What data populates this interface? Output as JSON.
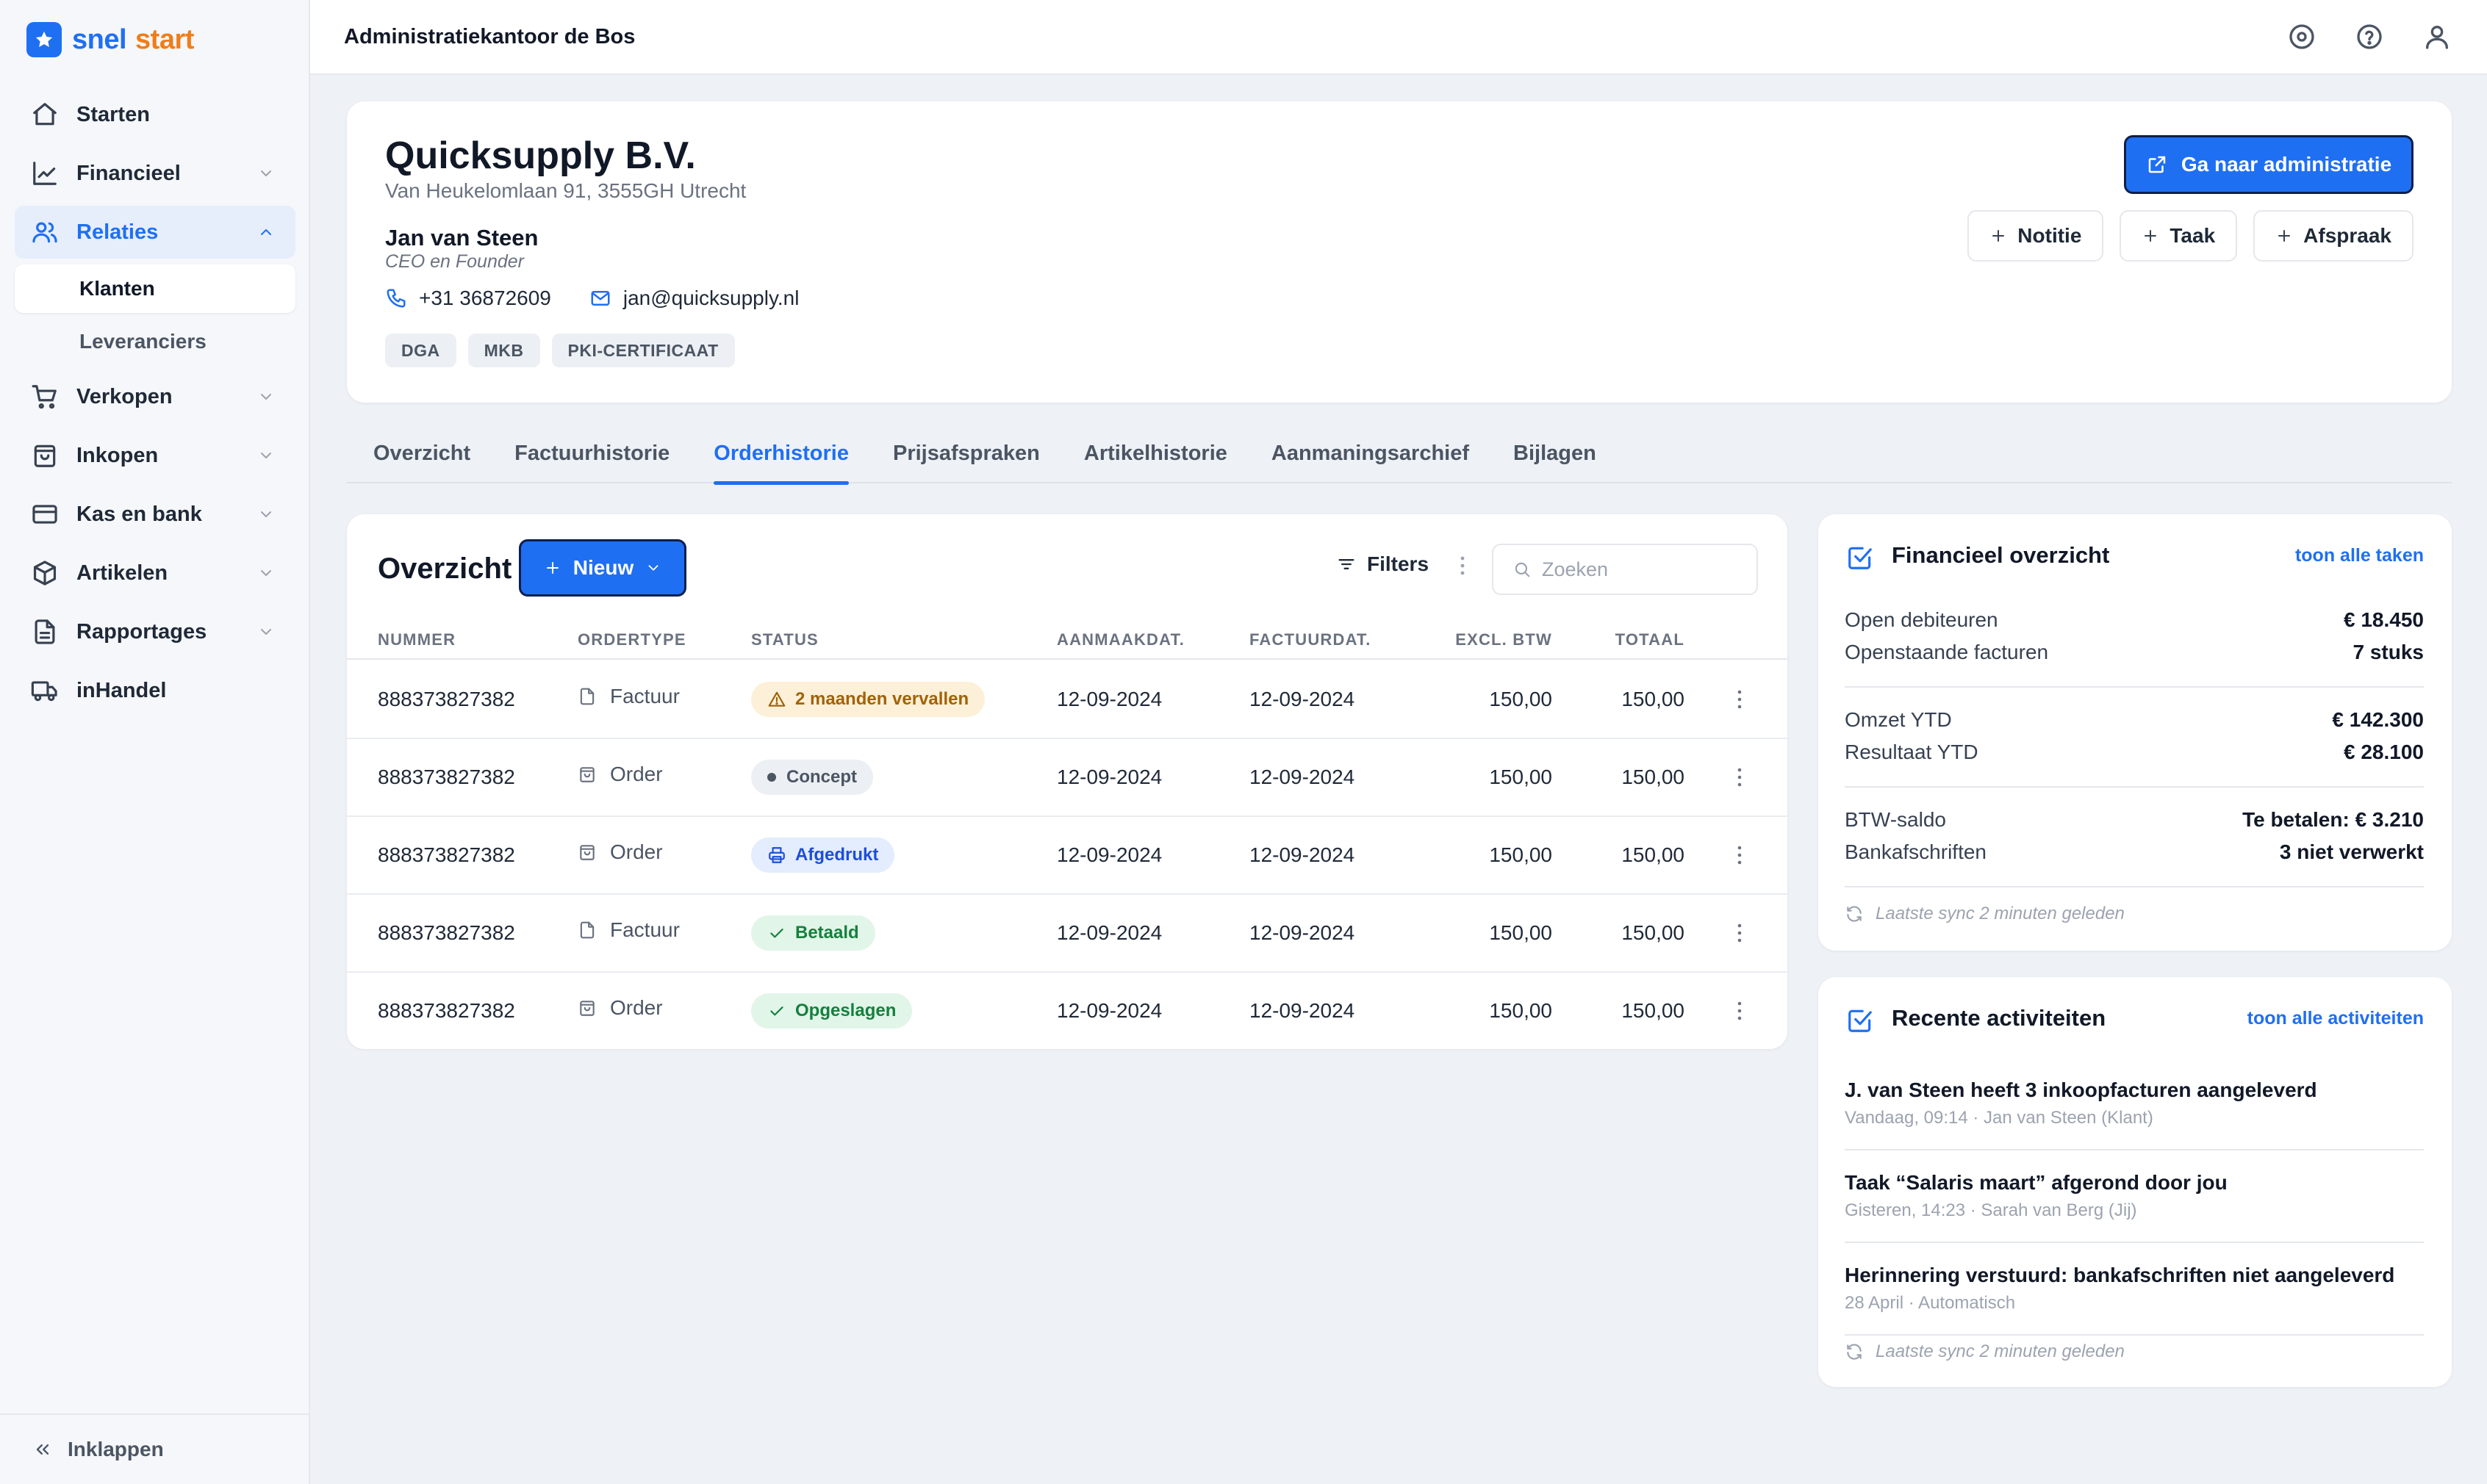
{
  "brand": {
    "part1": "snel",
    "part2": "start"
  },
  "sidebar": {
    "items": [
      {
        "label": "Starten",
        "icon": "home-icon"
      },
      {
        "label": "Financieel",
        "icon": "chart-line-icon"
      },
      {
        "label": "Relaties",
        "icon": "users-icon"
      },
      {
        "label": "Verkopen",
        "icon": "cart-icon"
      },
      {
        "label": "Inkopen",
        "icon": "shopping-bag-icon"
      },
      {
        "label": "Kas en bank",
        "icon": "credit-card-icon"
      },
      {
        "label": "Artikelen",
        "icon": "box-icon"
      },
      {
        "label": "Rapportages",
        "icon": "file-text-icon"
      },
      {
        "label": "inHandel",
        "icon": "truck-icon"
      }
    ],
    "sub_items": [
      {
        "label": "Klanten"
      },
      {
        "label": "Leveranciers"
      }
    ],
    "collapse_label": "Inklappen"
  },
  "topbar": {
    "title": "Administratiekantoor de Bos"
  },
  "customer": {
    "name": "Quicksupply B.V.",
    "address": "Van Heukelomlaan 91, 3555GH Utrecht",
    "contact_name": "Jan van Steen",
    "contact_role": "CEO en Founder",
    "phone": "+31 36872609",
    "email": "jan@quicksupply.nl",
    "tags": [
      "DGA",
      "MKB",
      "PKI-CERTIFICAAT"
    ],
    "primary_action": "Ga naar administratie",
    "actions": [
      "Notitie",
      "Taak",
      "Afspraak"
    ]
  },
  "tabs": [
    "Overzicht",
    "Factuurhistorie",
    "Orderhistorie",
    "Prijsafspraken",
    "Artikelhistorie",
    "Aanmaningsarchief",
    "Bijlagen"
  ],
  "orders": {
    "title": "Overzicht",
    "new_label": "Nieuw",
    "filters_label": "Filters",
    "search_placeholder": "Zoeken",
    "columns": [
      "NUMMER",
      "ORDERTYPE",
      "STATUS",
      "AANMAAKDAT.",
      "FACTUURDAT.",
      "EXCL. BTW",
      "TOTAAL"
    ],
    "rows": [
      {
        "number": "888373827382",
        "type": "Factuur",
        "status": "2 maanden vervallen",
        "created": "12-09-2024",
        "invoiced": "12-09-2024",
        "excl": "150,00",
        "total": "150,00"
      },
      {
        "number": "888373827382",
        "type": "Order",
        "status": "Concept",
        "created": "12-09-2024",
        "invoiced": "12-09-2024",
        "excl": "150,00",
        "total": "150,00"
      },
      {
        "number": "888373827382",
        "type": "Order",
        "status": "Afgedrukt",
        "created": "12-09-2024",
        "invoiced": "12-09-2024",
        "excl": "150,00",
        "total": "150,00"
      },
      {
        "number": "888373827382",
        "type": "Factuur",
        "status": "Betaald",
        "created": "12-09-2024",
        "invoiced": "12-09-2024",
        "excl": "150,00",
        "total": "150,00"
      },
      {
        "number": "888373827382",
        "type": "Order",
        "status": "Opgeslagen",
        "created": "12-09-2024",
        "invoiced": "12-09-2024",
        "excl": "150,00",
        "total": "150,00"
      }
    ]
  },
  "financial": {
    "title": "Financieel overzicht",
    "link": "toon alle taken",
    "rows": [
      {
        "label": "Open debiteuren",
        "value": "€ 18.450"
      },
      {
        "label": "Openstaande facturen",
        "value": "7 stuks"
      },
      {
        "label": "Omzet YTD",
        "value": "€ 142.300"
      },
      {
        "label": "Resultaat YTD",
        "value": "€ 28.100"
      },
      {
        "label": "BTW-saldo",
        "value": "Te betalen: € 3.210"
      },
      {
        "label": "Bankafschriften",
        "value": "3 niet verwerkt"
      }
    ],
    "sync": "Laatste sync 2 minuten geleden"
  },
  "activities": {
    "title": "Recente activiteiten",
    "link": "toon alle activiteiten",
    "items": [
      {
        "title": "J. van Steen heeft 3 inkoopfacturen aangeleverd",
        "meta": "Vandaag, 09:14 · Jan van Steen (Klant)"
      },
      {
        "title": "Taak “Salaris maart” afgerond door jou",
        "meta": "Gisteren, 14:23 · Sarah van Berg (Jij)"
      },
      {
        "title": "Herinnering verstuurd: bankafschriften niet aangeleverd",
        "meta": "28 April · Automatisch"
      }
    ],
    "sync": "Laatste sync 2 minuten geleden"
  },
  "colors": {
    "accent": "#1f6ff2",
    "brand_orange": "#f07d19",
    "status_overdue_bg": "#fdf0d8",
    "status_overdue_fg": "#a16207",
    "status_concept_bg": "#eceff3",
    "status_printed_bg": "#e3edfd",
    "status_paid_bg": "#e2f5e9",
    "status_paid_fg": "#15803d"
  }
}
